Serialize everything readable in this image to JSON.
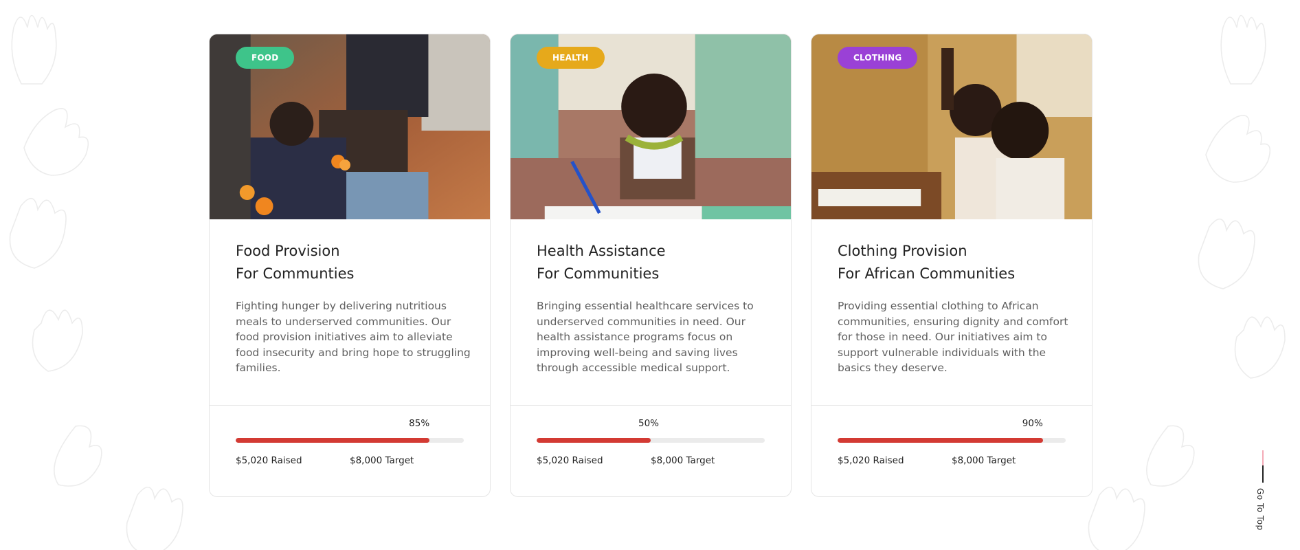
{
  "colors": {
    "food_badge": "#3ec48a",
    "health_badge": "#e6a91b",
    "clothing_badge": "#9a41d6",
    "progress_fill": "#d33a33",
    "progress_track": "#ebebeb"
  },
  "cards": [
    {
      "badge": "FOOD",
      "title_line1": "Food Provision",
      "title_line2": "For Communties",
      "description": "Fighting hunger by delivering nutritious meals to underserved communities. Our food provision initiatives aim to alleviate food insecurity and bring hope to struggling families.",
      "percent_label": "85%",
      "progress": 0.85,
      "raised": "$5,020 Raised",
      "target": "$8,000 Target",
      "image": "children-sharing-fruit-photo"
    },
    {
      "badge": "HEALTH",
      "title_line1": "Health Assistance",
      "title_line2": "For Communities",
      "description": "Bringing essential healthcare services to underserved communities in need. Our health assistance programs focus on improving well-being and saving lives through accessible medical support.",
      "percent_label": "50%",
      "progress": 0.5,
      "raised": "$5,020 Raised",
      "target": "$8,000 Target",
      "image": "smiling-child-writing-photo"
    },
    {
      "badge": "CLOTHING",
      "title_line1": "Clothing Provision",
      "title_line2": "For African Communities",
      "description": "Providing essential clothing to African communities, ensuring dignity and comfort for those in need. Our initiatives aim to support vulnerable individuals with the basics they deserve.",
      "percent_label": "90%",
      "progress": 0.9,
      "raised": "$5,020 Raised",
      "target": "$8,000 Target",
      "image": "girls-in-classroom-photo"
    }
  ],
  "go_top": {
    "label": "Go To Top"
  }
}
